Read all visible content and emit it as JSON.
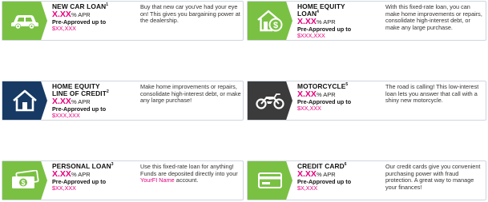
{
  "cards": [
    {
      "title": "NEW CAR LOAN",
      "sup": "1",
      "apr": "X.XX",
      "apr_unit": "% APR",
      "pre": "Pre-Approved up to",
      "amount": "$XX,XXX",
      "desc": "Buy that new car you've had your eye on! This gives you bargaining power at the dealership.",
      "icon": "car-icon"
    },
    {
      "title": "HOME EQUITY LOAN",
      "sup": "4",
      "apr": "X.XX",
      "apr_unit": "% APR",
      "pre": "Pre-Approved up to",
      "amount": "$XXX,XXX",
      "desc": "With this fixed-rate loan, you can make home improvements or repairs, consolidate high-interest debt, or make any large purchase.",
      "icon": "house-dollar-icon"
    },
    {
      "title_line1": "HOME EQUITY",
      "title_line2": "LINE OF CREDIT",
      "sup": "2",
      "apr": "X.XX",
      "apr_unit": "% APR",
      "pre": "Pre-Approved up to",
      "amount": "$XXX,XXX",
      "desc": "Make home improvements or repairs, consolidate high-interest debt, or make any large purchase!",
      "icon": "house-icon"
    },
    {
      "title": "MOTORCYCLE",
      "sup": "5",
      "apr": "X.XX",
      "apr_unit": "% APR",
      "pre": "Pre-Approved up to",
      "amount": "$XX,XXX",
      "desc": "The road is calling! This low-interest loan lets you answer that call with a shiny new motorcycle.",
      "icon": "motorcycle-icon"
    },
    {
      "title": "PERSONAL LOAN",
      "sup": "3",
      "apr": "X.XX",
      "apr_unit": "% APR",
      "pre": "Pre-Approved up to",
      "amount": "$XX,XXX",
      "desc_before": "Use this fixed-rate loan for anything! Funds are deposited directly into your ",
      "desc_brand": "YourFI Name",
      "desc_after": " account.",
      "icon": "cash-icon"
    },
    {
      "title": "CREDIT CARD",
      "sup": "6",
      "apr": "X.XX",
      "apr_unit": "% APR",
      "pre": "Pre-Approved up to",
      "amount": "$X,XXX",
      "desc": "Our credit cards give you convenient purchasing power with fraud protection. A great way to manage your finances!",
      "icon": "credit-card-icon"
    }
  ],
  "colors": {
    "green": "#7ac143",
    "navy": "#173a64",
    "dark": "#3b3b3b",
    "magenta": "#e6007e"
  }
}
